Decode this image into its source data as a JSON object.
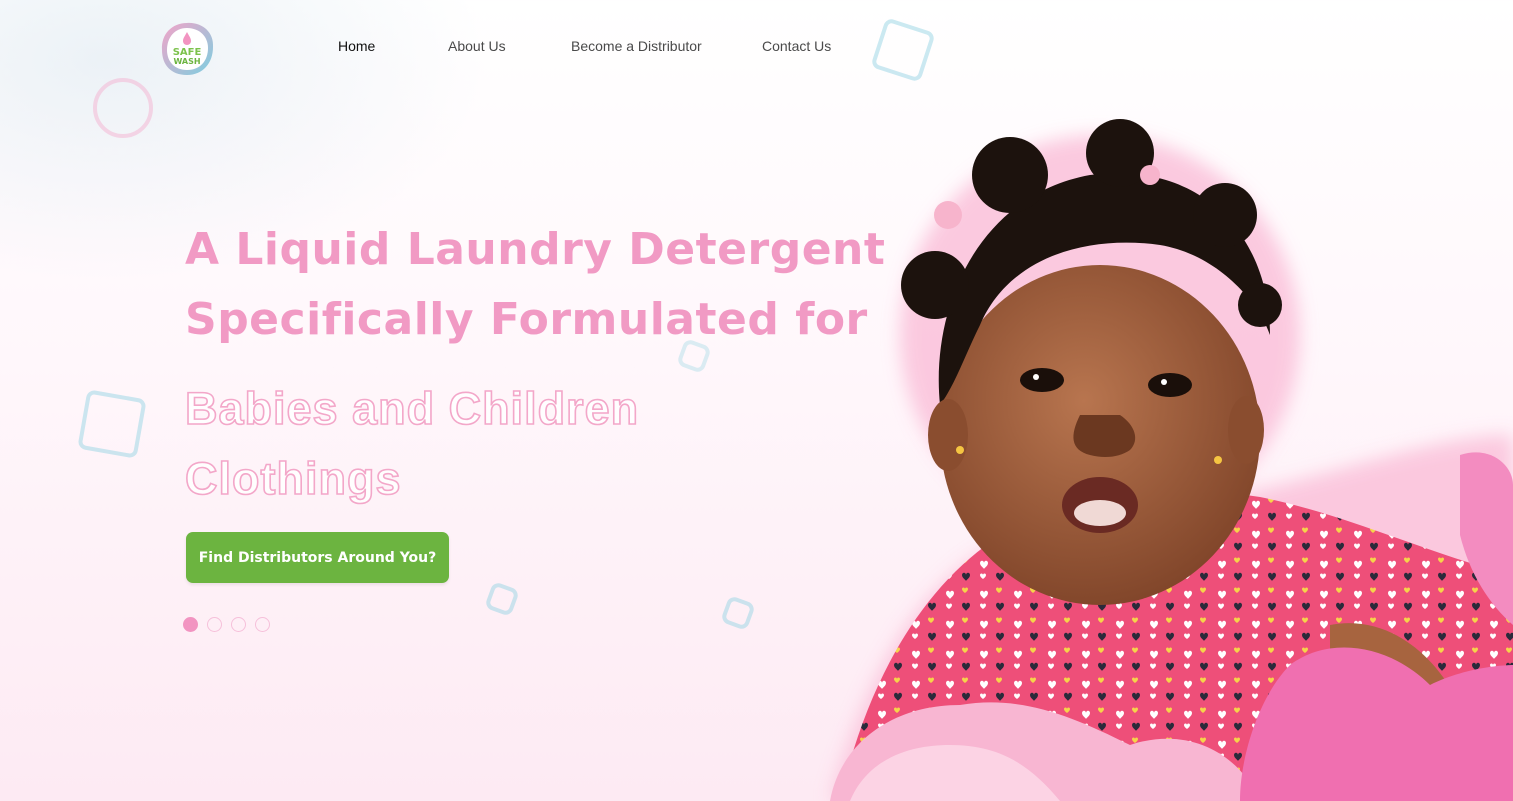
{
  "brand": {
    "logo_text_top": "SAFE",
    "logo_text_bottom": "WASH"
  },
  "nav": {
    "items": [
      {
        "label": "Home",
        "active": true
      },
      {
        "label": "About Us",
        "active": false
      },
      {
        "label": "Become a Distributor",
        "active": false
      },
      {
        "label": "Contact Us",
        "active": false
      }
    ]
  },
  "hero": {
    "line1": "A Liquid Laundry Detergent",
    "line2": "Specifically Formulated for",
    "outline_line1": "Babies and Children",
    "outline_line2": "Clothings",
    "cta_label": "Find Distributors Around You?"
  },
  "slider": {
    "total": 4,
    "active_index": 0
  },
  "colors": {
    "accent_pink": "#f19ac4",
    "button_green": "#6cb440",
    "dot_active": "#f294c1"
  }
}
